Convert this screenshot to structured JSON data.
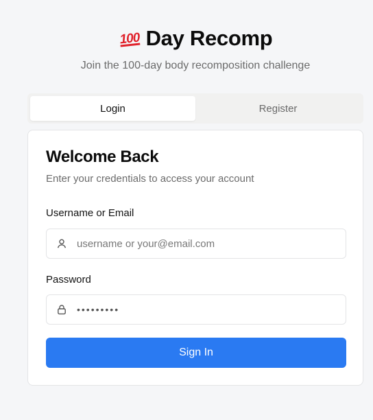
{
  "header": {
    "logo_emoji": "100",
    "title": "Day Recomp",
    "subtitle": "Join the 100-day body recomposition challenge"
  },
  "tabs": [
    {
      "label": "Login",
      "active": true
    },
    {
      "label": "Register",
      "active": false
    }
  ],
  "card": {
    "title": "Welcome Back",
    "description": "Enter your credentials to access your account",
    "username": {
      "label": "Username or Email",
      "placeholder": "username or your@email.com",
      "value": "",
      "icon": "user-icon"
    },
    "password": {
      "label": "Password",
      "value": "•••••••••",
      "icon": "lock-icon"
    },
    "submit_label": "Sign In"
  },
  "colors": {
    "primary": "#2a7af2",
    "background": "#f5f6f8",
    "emoji": "#e0202a"
  }
}
